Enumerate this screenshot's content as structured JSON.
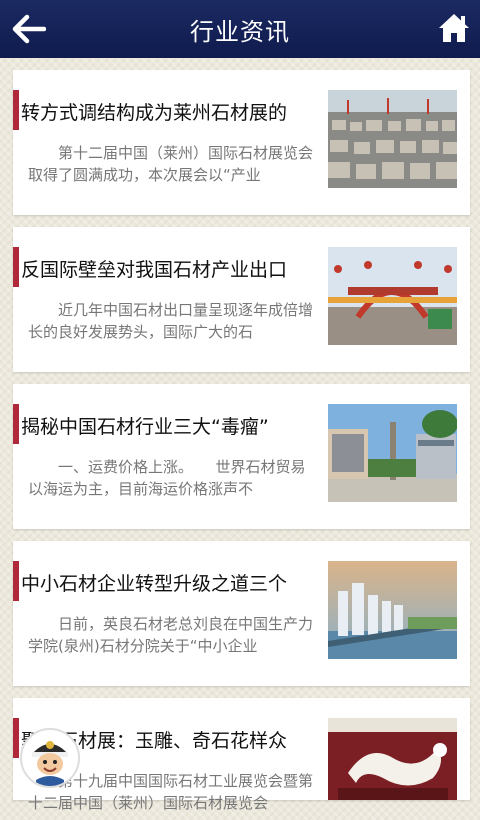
{
  "header": {
    "title": "行业资讯",
    "back_icon": "back-arrow-icon",
    "home_icon": "home-icon"
  },
  "articles": [
    {
      "title": "转方式调结构成为莱州石材展的",
      "summary": "第十二届中国（莱州）国际石材展览会取得了圆满成功，本次展会以“产业",
      "image": "stone-yard-image"
    },
    {
      "title": "反国际壁垒对我国石材产业出口",
      "summary": "近几年中国石材出口量呈现逐年成倍增长的良好发展势头，国际广大的石",
      "image": "stone-expo-gate-image"
    },
    {
      "title": "揭秘中国石材行业三大“毒瘤”",
      "summary": "一、运费价格上涨。　　世界石材贸易以海运为主，目前海运价格涨声不",
      "image": "plaza-building-image"
    },
    {
      "title": "中小石材企业转型升级之道三个",
      "summary": "日前，英良石材老总刘良在中国生产力学院(泉州)石材分院关于“中小企业",
      "image": "city-skyline-image"
    },
    {
      "title": "聚焦石材展：玉雕、奇石花样众",
      "summary": "第十九届中国国际石材工业展览会暨第十二届中国（莱州）国际石材展览会",
      "image": "jade-dragon-carving-image"
    }
  ],
  "mascot": {
    "icon": "sailor-mascot-icon"
  }
}
